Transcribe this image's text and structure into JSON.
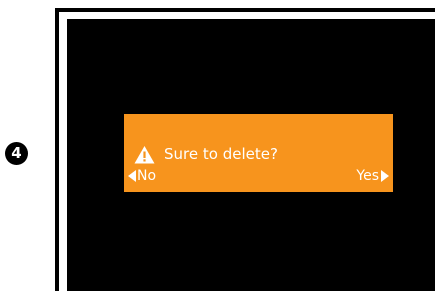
{
  "step": {
    "number": "4"
  },
  "dialog": {
    "icon": "warning-icon",
    "message": "Sure to delete?",
    "background_color": "#f7941d",
    "text_color": "#ffffff",
    "buttons": {
      "no": {
        "label": "No",
        "icon": "left-arrow-icon"
      },
      "yes": {
        "label": "Yes",
        "icon": "right-arrow-icon"
      }
    }
  },
  "screen": {
    "background_color": "#000000"
  }
}
